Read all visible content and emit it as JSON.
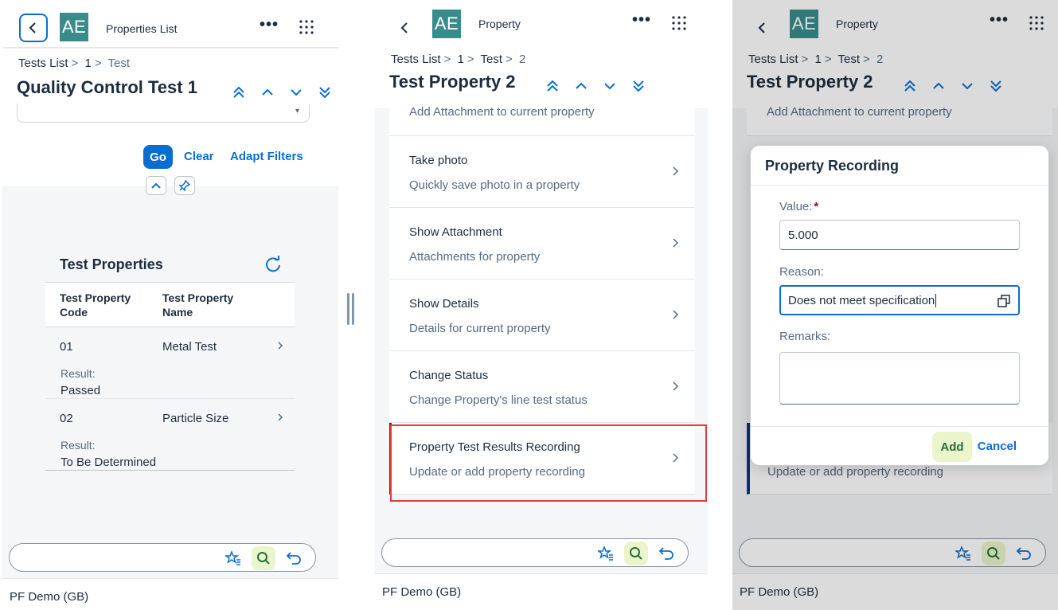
{
  "panel1": {
    "shell_title": "Properties List",
    "app_logo": "AE",
    "breadcrumb": [
      "Tests List",
      "1",
      "Test"
    ],
    "title": "Quality Control Test 1",
    "filter": {
      "go": "Go",
      "clear": "Clear",
      "adapt": "Adapt Filters"
    },
    "table": {
      "title": "Test Properties",
      "col1": "Test Property Code",
      "col2": "Test Property Name",
      "rows": [
        {
          "code": "01",
          "name": "Metal Test",
          "result_label": "Result:",
          "result": "Passed"
        },
        {
          "code": "02",
          "name": "Particle Size",
          "result_label": "Result:",
          "result": "To Be Determined"
        }
      ]
    },
    "footer": "PF Demo (GB)"
  },
  "panel2": {
    "shell_title": "Property",
    "app_logo": "AE",
    "breadcrumb": [
      "Tests List",
      "1",
      "Test",
      "2"
    ],
    "title": "Test Property 2",
    "partial_item_sub": "Add Attachment to current property",
    "items": [
      {
        "title": "Take photo",
        "sub": "Quickly save photo in a property"
      },
      {
        "title": "Show Attachment",
        "sub": "Attachments for property"
      },
      {
        "title": "Show Details",
        "sub": "Details for current property"
      },
      {
        "title": "Change Status",
        "sub": "Change Property's line test status"
      },
      {
        "title": "Property Test Results Recording",
        "sub": "Update or add property recording"
      }
    ],
    "footer": "PF Demo (GB)"
  },
  "panel3": {
    "shell_title": "Property",
    "app_logo": "AE",
    "breadcrumb": [
      "Tests List",
      "1",
      "Test",
      "2"
    ],
    "title": "Test Property 2",
    "partial_item_sub": "Add Attachment to current property",
    "behind_item_sub": "Update or add property recording",
    "dialog": {
      "title": "Property Recording",
      "value_label": "Value:",
      "required_mark": "*",
      "value": "5.000",
      "reason_label": "Reason:",
      "reason": "Does not meet specification",
      "remarks_label": "Remarks:",
      "add": "Add",
      "cancel": "Cancel"
    },
    "footer": "PF Demo (GB)"
  },
  "colors": {
    "accent": "#0a6ed1",
    "highlight_border": "#e03c3c",
    "logo": "#3a8c8c",
    "positive_bg": "#ebf5cb"
  }
}
